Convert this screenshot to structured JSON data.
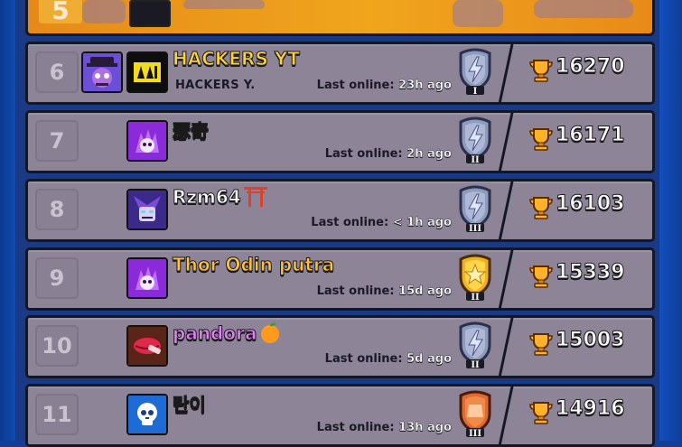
{
  "leaderboard": {
    "top_partial_rank": "5",
    "rows": [
      {
        "rank": "6",
        "name": "HACKERS YT",
        "name_color": "#ffd23a",
        "club_name": "HACKERS Y.",
        "last_online_label": "Last online:",
        "last_online_value": "23h ago",
        "trophies": "16270",
        "badge_tier": "I",
        "badge_color": "silver",
        "profile_icon": "brawler-portrait-icon",
        "club_icon": "navi-club-icon",
        "name_suffix_icon": ""
      },
      {
        "rank": "7",
        "name": "瑟奇",
        "name_color": "#ff6a52",
        "club_name": "",
        "last_online_label": "Last online:",
        "last_online_value": "2h ago",
        "trophies": "16171",
        "badge_tier": "II",
        "badge_color": "silver",
        "profile_icon": "purple-skull-icon",
        "club_icon": "",
        "name_suffix_icon": ""
      },
      {
        "rank": "8",
        "name": "Rzm64",
        "name_color": "#ffffff",
        "club_name": "",
        "last_online_label": "Last online:",
        "last_online_value": "< 1h ago",
        "trophies": "16103",
        "badge_tier": "III",
        "badge_color": "silver",
        "profile_icon": "mortis-portrait-icon",
        "club_icon": "",
        "name_suffix_icon": "torii-gate-icon"
      },
      {
        "rank": "9",
        "name": "Thor Odin putra",
        "name_color": "#ffc23a",
        "club_name": "",
        "last_online_label": "Last online:",
        "last_online_value": "15d ago",
        "trophies": "15339",
        "badge_tier": "II",
        "badge_color": "gold",
        "profile_icon": "purple-skull-icon",
        "club_icon": "",
        "name_suffix_icon": ""
      },
      {
        "rank": "10",
        "name": "pandora",
        "name_color": "#e77cff",
        "club_name": "",
        "last_online_label": "Last online:",
        "last_online_value": "5d ago",
        "trophies": "15003",
        "badge_tier": "II",
        "badge_color": "silver",
        "profile_icon": "lips-icon",
        "club_icon": "",
        "name_suffix_icon": "orange-fruit-icon"
      },
      {
        "rank": "11",
        "name": "란이",
        "name_color": "#ffd23a",
        "club_name": "",
        "last_online_label": "Last online:",
        "last_online_value": "13h ago",
        "trophies": "14916",
        "badge_tier": "III",
        "badge_color": "bronze",
        "profile_icon": "white-skull-icon",
        "club_icon": "",
        "name_suffix_icon": ""
      }
    ]
  }
}
